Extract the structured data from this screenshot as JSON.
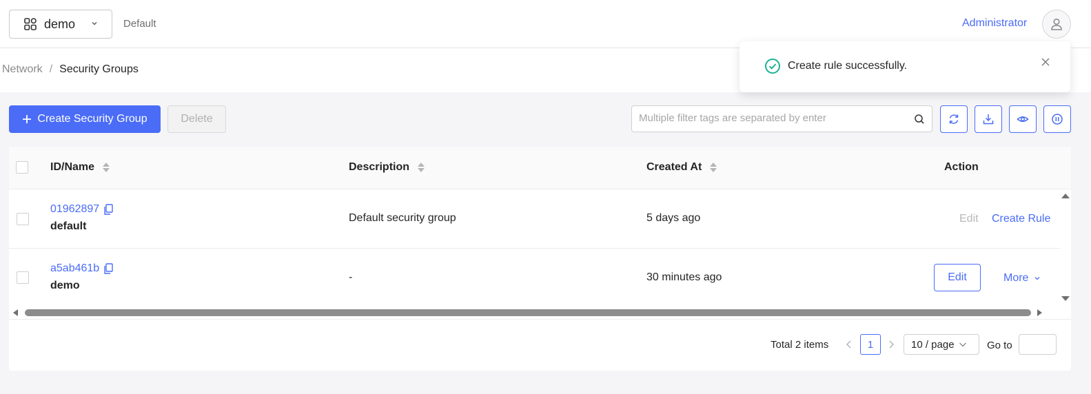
{
  "header": {
    "project": "demo",
    "region": "Default",
    "user": "Administrator"
  },
  "breadcrumb": {
    "parent": "Network",
    "separator": "/",
    "current": "Security Groups"
  },
  "toast": {
    "message": "Create rule successfully.",
    "status_color": "#19b394"
  },
  "toolbar": {
    "create_label": "Create Security Group",
    "delete_label": "Delete",
    "search_placeholder": "Multiple filter tags are separated by enter",
    "icons": [
      "refresh-icon",
      "download-icon",
      "eye-icon",
      "pause-icon"
    ]
  },
  "table": {
    "columns": [
      "ID/Name",
      "Description",
      "Created At",
      "Action"
    ],
    "rows": [
      {
        "id": "01962897",
        "name": "default",
        "description": "Default security group",
        "created_at": "5 days ago",
        "actions": {
          "edit": "Edit",
          "secondary": "Create Rule"
        }
      },
      {
        "id": "a5ab461b",
        "name": "demo",
        "description": "-",
        "created_at": "30 minutes ago",
        "actions": {
          "edit": "Edit",
          "secondary": "More"
        }
      }
    ]
  },
  "pagination": {
    "total": "Total 2 items",
    "current_page": "1",
    "page_size": "10 / page",
    "goto_label": "Go to"
  },
  "colors": {
    "accent": "#4a6cf7",
    "disabled": "#b8b8b8"
  }
}
